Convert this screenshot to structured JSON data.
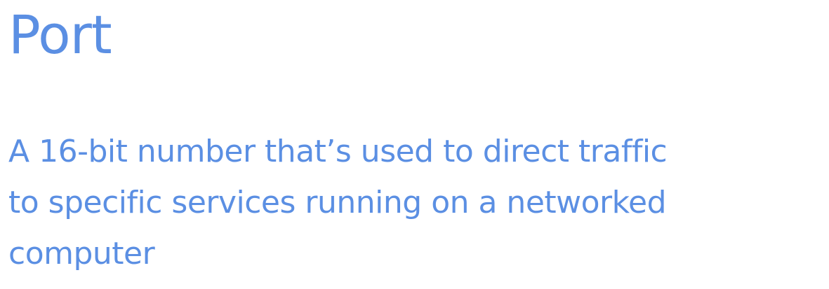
{
  "slide": {
    "title": "Port",
    "definition_lines": [
      "A 16-bit number that’s used to direct traffic",
      "to specific services running on a networked",
      "computer"
    ]
  },
  "colors": {
    "text": "#5b8fe3",
    "background": "#ffffff"
  }
}
